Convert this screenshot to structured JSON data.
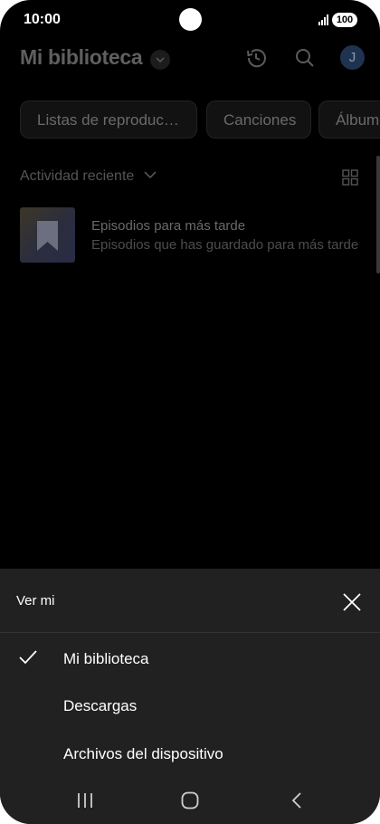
{
  "status": {
    "time": "10:00",
    "battery": "100"
  },
  "header": {
    "title": "Mi biblioteca",
    "avatar_initial": "J"
  },
  "chips": [
    {
      "label": "Listas de reproduc…"
    },
    {
      "label": "Canciones"
    },
    {
      "label": "Álbumes"
    }
  ],
  "recent": {
    "label": "Actividad reciente"
  },
  "items": [
    {
      "title": "Episodios para más tarde",
      "subtitle": "Episodios que has guardado para más tarde"
    }
  ],
  "sheet": {
    "title": "Ver mi",
    "options": [
      {
        "label": "Mi biblioteca",
        "selected": true
      },
      {
        "label": "Descargas",
        "selected": false
      },
      {
        "label": "Archivos del dispositivo",
        "selected": false
      }
    ]
  }
}
